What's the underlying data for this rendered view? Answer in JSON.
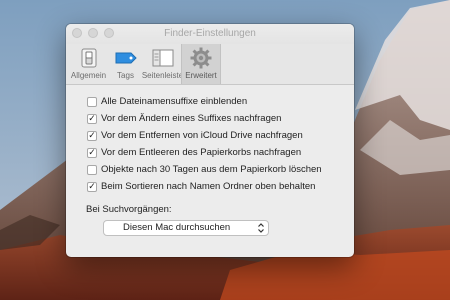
{
  "window": {
    "title": "Finder-Einstellungen"
  },
  "toolbar": {
    "items": [
      {
        "label": "Allgemein",
        "icon": "switch-icon",
        "active": false
      },
      {
        "label": "Tags",
        "icon": "tag-icon",
        "active": false
      },
      {
        "label": "Seitenleiste",
        "icon": "sidebar-icon",
        "active": false
      },
      {
        "label": "Erweitert",
        "icon": "gear-icon",
        "active": true
      }
    ]
  },
  "options": [
    {
      "label": "Alle Dateinamensuffixe einblenden",
      "checked": false
    },
    {
      "label": "Vor dem Ändern eines Suffixes nachfragen",
      "checked": true
    },
    {
      "label": "Vor dem Entfernen von iCloud Drive nachfragen",
      "checked": true
    },
    {
      "label": "Vor dem Entleeren des Papierkorbs nachfragen",
      "checked": true
    },
    {
      "label": "Objekte nach 30 Tagen aus dem Papierkorb löschen",
      "checked": false
    },
    {
      "label": "Beim Sortieren nach Namen Ordner oben behalten",
      "checked": true
    }
  ],
  "search": {
    "section_label": "Bei Suchvorgängen:",
    "selected": "Diesen Mac durchsuchen"
  },
  "colors": {
    "tag_blue": "#2f8ee0",
    "window_bg": "#ececec"
  }
}
